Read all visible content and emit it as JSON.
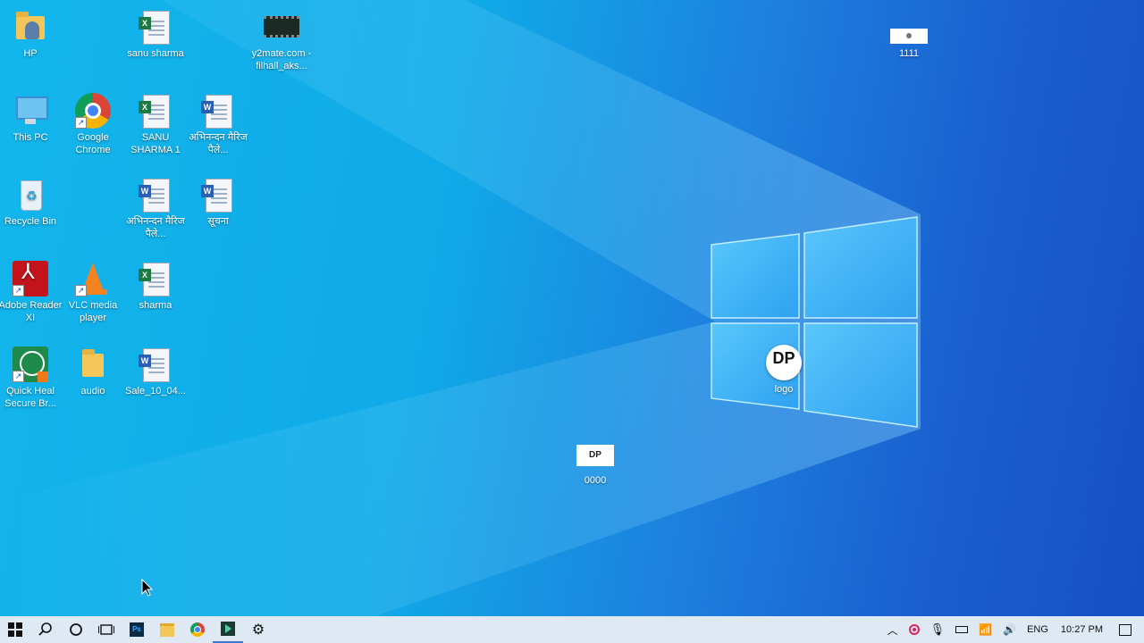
{
  "desktop": {
    "icons": [
      {
        "id": "hp",
        "label": "HP"
      },
      {
        "id": "sanu-sharma",
        "label": "sanu sharma"
      },
      {
        "id": "y2mate",
        "label": "y2mate.com - filhall_aks..."
      },
      {
        "id": "1111",
        "label": "1111"
      },
      {
        "id": "this-pc",
        "label": "This PC"
      },
      {
        "id": "google-chrome",
        "label": "Google Chrome"
      },
      {
        "id": "sanu-sharma-1",
        "label": "SANU SHARMA 1"
      },
      {
        "id": "abhinandan-1",
        "label": "अभिनन्दन मैरिज पैले..."
      },
      {
        "id": "recycle-bin",
        "label": "Recycle Bin"
      },
      {
        "id": "abhinandan-2",
        "label": "अभिनन्दन मैरिज पैले..."
      },
      {
        "id": "suchna",
        "label": "सूचना"
      },
      {
        "id": "adobe-reader",
        "label": "Adobe Reader XI"
      },
      {
        "id": "vlc",
        "label": "VLC media player"
      },
      {
        "id": "sharma",
        "label": "sharma"
      },
      {
        "id": "logo",
        "label": "logo"
      },
      {
        "id": "quick-heal",
        "label": "Quick Heal Secure Br..."
      },
      {
        "id": "audio",
        "label": "audio"
      },
      {
        "id": "sale",
        "label": "Sale_10_04..."
      },
      {
        "id": "0000",
        "label": "0000"
      }
    ],
    "logo_text": "DP"
  },
  "taskbar": {
    "tray": {
      "language": "ENG",
      "time": "10:27 PM"
    }
  },
  "colors": {
    "taskbar_bg": "#dfe9f3",
    "wallpaper_light": "#12b6ec",
    "wallpaper_dark": "#1550c4"
  }
}
